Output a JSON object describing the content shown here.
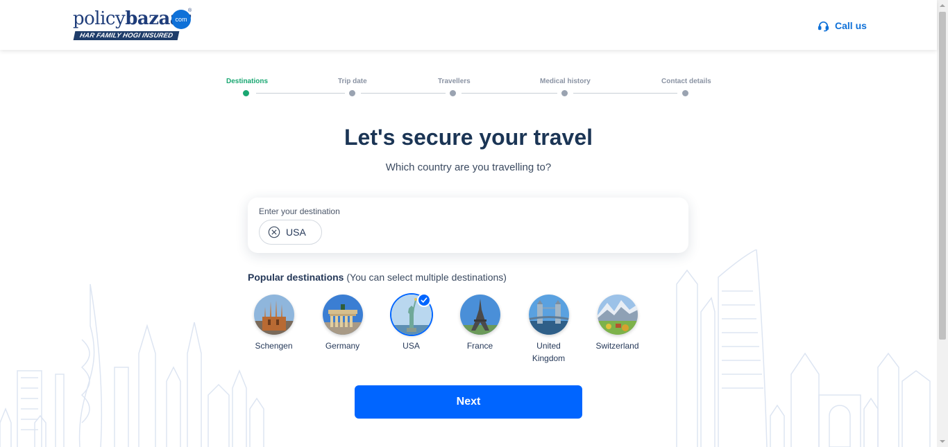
{
  "header": {
    "logo_policy": "policy",
    "logo_bazaar": "bazaar",
    "logo_com": "com",
    "logo_tagline": "HAR FAMILY HOGI INSURED",
    "call_us": "Call us"
  },
  "stepper": {
    "steps": [
      {
        "label": "Destinations",
        "state": "active"
      },
      {
        "label": "Trip date",
        "state": "pending"
      },
      {
        "label": "Travellers",
        "state": "pending"
      },
      {
        "label": "Medical history",
        "state": "pending"
      },
      {
        "label": "Contact details",
        "state": "pending"
      }
    ]
  },
  "main": {
    "title": "Let's secure your travel",
    "subtitle": "Which country are you travelling to?"
  },
  "destination_input": {
    "label": "Enter your destination",
    "selected_chip": "USA"
  },
  "popular": {
    "heading": "Popular destinations",
    "hint": "(You can select multiple destinations)",
    "countries": [
      {
        "name": "Schengen",
        "selected": false,
        "icon": "sagrada-familia-image"
      },
      {
        "name": "Germany",
        "selected": false,
        "icon": "brandenburg-gate-image"
      },
      {
        "name": "USA",
        "selected": true,
        "icon": "statue-of-liberty-image"
      },
      {
        "name": "France",
        "selected": false,
        "icon": "eiffel-tower-image"
      },
      {
        "name": "United Kingdom",
        "selected": false,
        "icon": "tower-bridge-image"
      },
      {
        "name": "Switzerland",
        "selected": false,
        "icon": "swiss-alps-image"
      }
    ]
  },
  "actions": {
    "next_label": "Next"
  },
  "colors": {
    "primary": "#0065ff",
    "active_step": "#1aa772",
    "heading": "#1b3555",
    "brand": "#1f3d7a"
  }
}
